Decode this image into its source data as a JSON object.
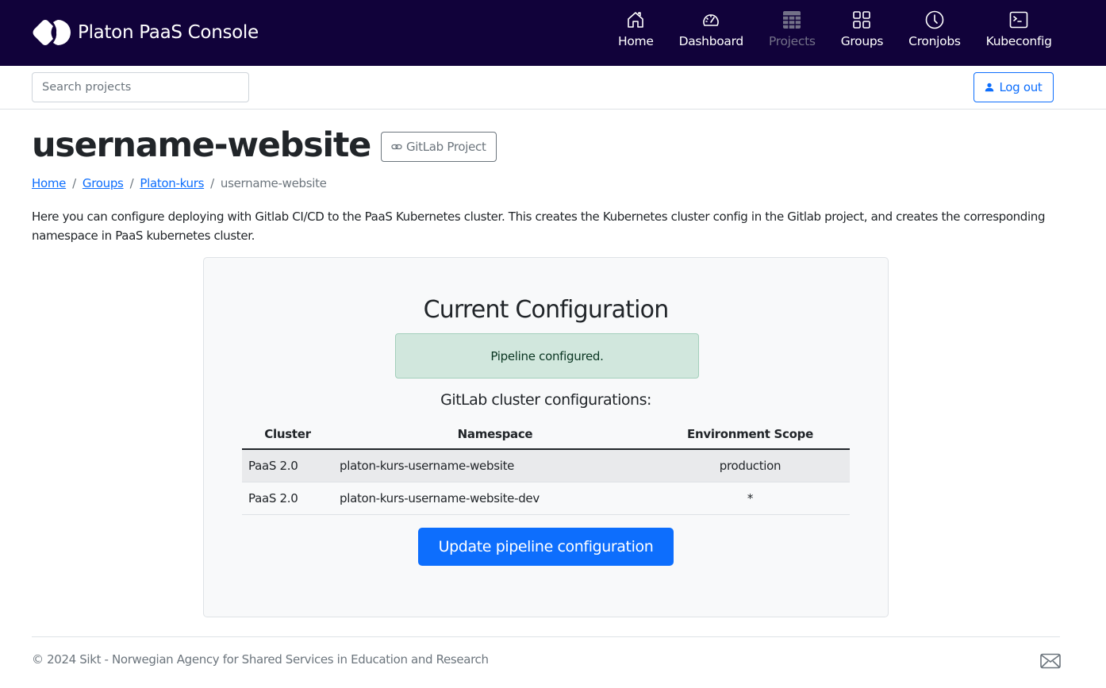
{
  "navbar": {
    "brand": "Platon PaaS Console",
    "items": [
      {
        "label": "Home",
        "icon": "home-icon",
        "disabled": false
      },
      {
        "label": "Dashboard",
        "icon": "speedometer-icon",
        "disabled": false
      },
      {
        "label": "Projects",
        "icon": "table-icon",
        "disabled": true
      },
      {
        "label": "Groups",
        "icon": "grid-icon",
        "disabled": false
      },
      {
        "label": "Cronjobs",
        "icon": "clock-icon",
        "disabled": false
      },
      {
        "label": "Kubeconfig",
        "icon": "terminal-icon",
        "disabled": false
      }
    ]
  },
  "subbar": {
    "search_placeholder": "Search projects",
    "search_value": "",
    "logout_label": "Log out"
  },
  "page": {
    "title": "username-website",
    "gitlab_button": "GitLab Project",
    "breadcrumb": [
      {
        "label": "Home",
        "link": true
      },
      {
        "label": "Groups",
        "link": true
      },
      {
        "label": "Platon-kurs",
        "link": true
      },
      {
        "label": "username-website",
        "link": false
      }
    ],
    "intro": "Here you can configure deploying with Gitlab CI/CD to the PaaS Kubernetes cluster. This creates the Kubernetes cluster config in the Gitlab project, and creates the corresponding namespace in PaaS kubernetes cluster."
  },
  "config": {
    "title": "Current Configuration",
    "alert": "Pipeline configured.",
    "subtitle": "GitLab cluster configurations:",
    "table": {
      "headers": [
        "Cluster",
        "Namespace",
        "Environment Scope"
      ],
      "rows": [
        [
          "PaaS 2.0",
          "platon-kurs-username-website",
          "production"
        ],
        [
          "PaaS 2.0",
          "platon-kurs-username-website-dev",
          "*"
        ]
      ]
    },
    "update_button": "Update pipeline configuration"
  },
  "footer": {
    "copyright": "© 2024 Sikt - Norwegian Agency for Shared Services in Education and Research"
  },
  "colors": {
    "navbar_bg": "#11023a",
    "primary": "#0d6efd",
    "success_bg": "#d1e7dd",
    "success_text": "#0a3622"
  }
}
